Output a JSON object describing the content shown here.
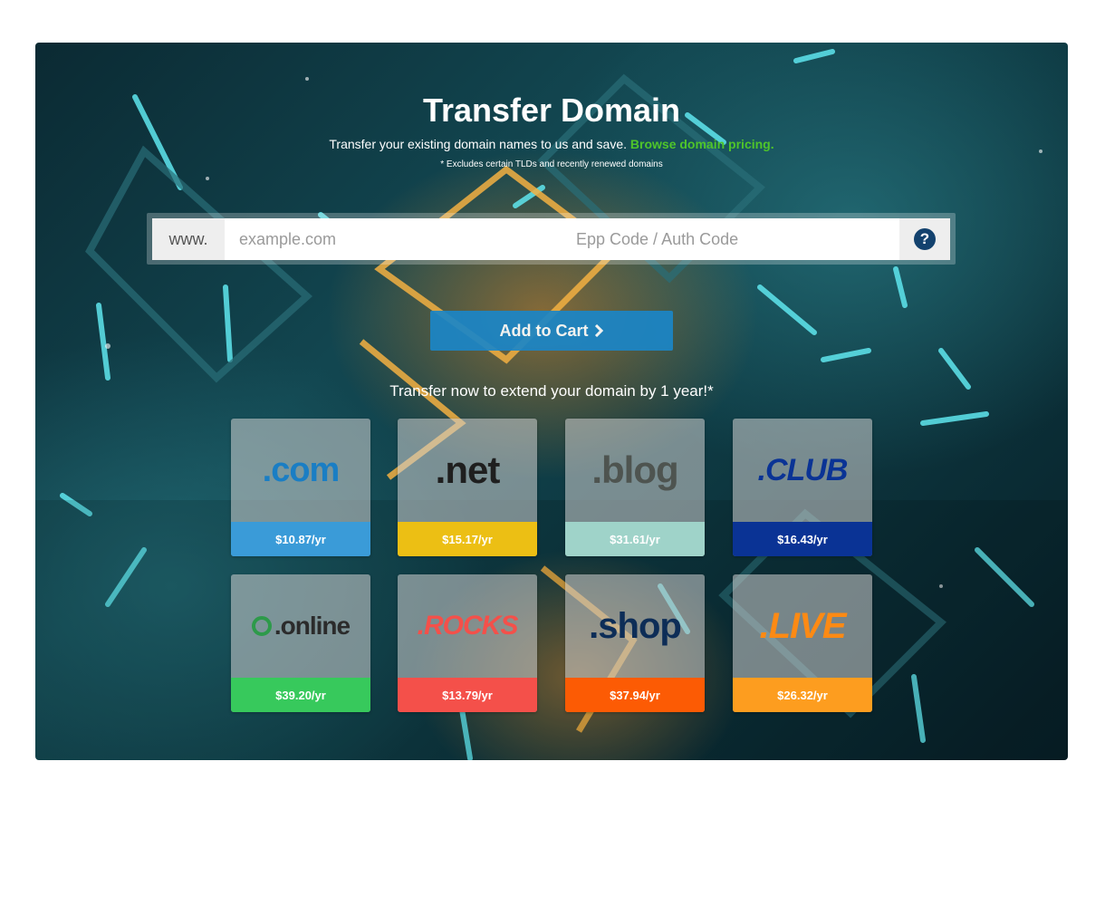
{
  "hero": {
    "title": "Transfer Domain",
    "subtitle_text": "Transfer your existing domain names to us and save.",
    "subtitle_link": "Browse domain pricing.",
    "note": "* Excludes certain TLDs and recently renewed domains"
  },
  "search": {
    "prefix": "www.",
    "domain_placeholder": "example.com",
    "epp_placeholder": "Epp Code / Auth Code",
    "help_glyph": "?"
  },
  "cart_button": {
    "label": "Add to Cart",
    "icon": "chevron-right-icon",
    "color": "#1b86c7"
  },
  "promo": "Transfer now to extend your domain by 1 year!*",
  "tlds": [
    {
      "name": ".com",
      "logo_text": ".com",
      "price": "$10.87/yr",
      "color": "#3a9bd8"
    },
    {
      "name": ".net",
      "logo_text": ".net",
      "price": "$15.17/yr",
      "color": "#ecbf14"
    },
    {
      "name": ".blog",
      "logo_text": ".blog",
      "price": "$31.61/yr",
      "color": "#9fd3c9"
    },
    {
      "name": ".club",
      "logo_text": ".CLUB",
      "price": "$16.43/yr",
      "color": "#0a3395"
    },
    {
      "name": ".online",
      "logo_text": ".online",
      "price": "$39.20/yr",
      "color": "#37c95c"
    },
    {
      "name": ".rocks",
      "logo_text": ".ROCKS",
      "price": "$13.79/yr",
      "color": "#f4504a"
    },
    {
      "name": ".shop",
      "logo_text": ".shop",
      "price": "$37.94/yr",
      "color": "#fc5b04"
    },
    {
      "name": ".live",
      "logo_text": ".LIVE",
      "price": "$26.32/yr",
      "color": "#fd9d1f"
    }
  ]
}
